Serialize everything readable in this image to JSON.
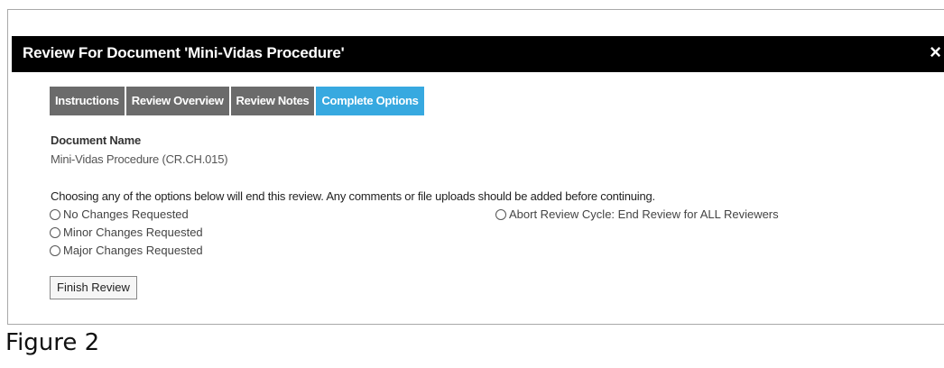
{
  "dialog": {
    "title": "Review For Document 'Mini-Vidas Procedure'",
    "close_icon": "×"
  },
  "tabs": [
    {
      "label": "Instructions",
      "active": false
    },
    {
      "label": "Review Overview",
      "active": false
    },
    {
      "label": "Review Notes",
      "active": false
    },
    {
      "label": "Complete Options",
      "active": true
    }
  ],
  "document": {
    "name_label": "Document Name",
    "name_value": "Mini-Vidas Procedure (CR.CH.015)"
  },
  "notice": "Choosing any of the options below will end this review. Any comments or file uploads should be added before continuing.",
  "options": {
    "no_changes": "No Changes Requested",
    "minor_changes": "Minor Changes Requested",
    "major_changes": "Major Changes Requested",
    "abort": "Abort Review Cycle: End Review for ALL Reviewers"
  },
  "finish_button": "Finish Review",
  "caption": "Figure 2",
  "colors": {
    "title_bar": "#000000",
    "tab_inactive": "#6b6b6b",
    "tab_active": "#37a9e0"
  }
}
